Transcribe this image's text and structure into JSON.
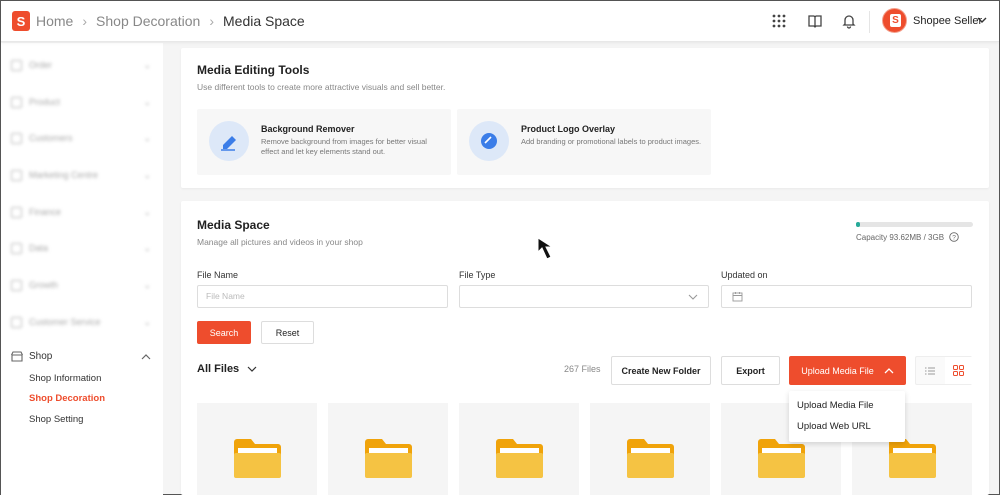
{
  "topbar": {
    "logo_letter": "S",
    "breadcrumb": [
      "Home",
      "Shop Decoration",
      "Media Space"
    ],
    "user_name": "Shopee Seller",
    "avatar_letter": "S"
  },
  "sidebar": {
    "blurred_items": [
      "Order",
      "Product",
      "Customers",
      "Marketing Centre",
      "Finance",
      "Data",
      "Growth",
      "Customer Service"
    ],
    "shop_label": "Shop",
    "shop_items": [
      "Shop Information",
      "Shop Decoration",
      "Shop Setting"
    ]
  },
  "tools": {
    "title": "Media Editing Tools",
    "desc": "Use different tools to create more attractive visuals and sell better.",
    "items": [
      {
        "title": "Background Remover",
        "desc": "Remove background from images for better visual effect and let key elements stand out."
      },
      {
        "title": "Product Logo Overlay",
        "desc": "Add branding or promotional labels to product images."
      }
    ]
  },
  "media": {
    "title": "Media Space",
    "desc": "Manage all pictures and videos in your shop",
    "capacity": "Capacity 93.62MB / 3GB",
    "capacity_fraction": 0.03,
    "file_name_label": "File Name",
    "file_name_placeholder": "File Name",
    "file_type_label": "File Type",
    "updated_label": "Updated on",
    "search": "Search",
    "reset": "Reset",
    "all_files": "All Files",
    "count": "267 Files",
    "create_folder": "Create New Folder",
    "export": "Export",
    "upload": "Upload Media File",
    "dropdown": [
      "Upload Media File",
      "Upload Web URL"
    ]
  },
  "colors": {
    "brand": "#ee4d2d",
    "folder": "#f5c343",
    "folder_tab": "#f0a30a"
  }
}
